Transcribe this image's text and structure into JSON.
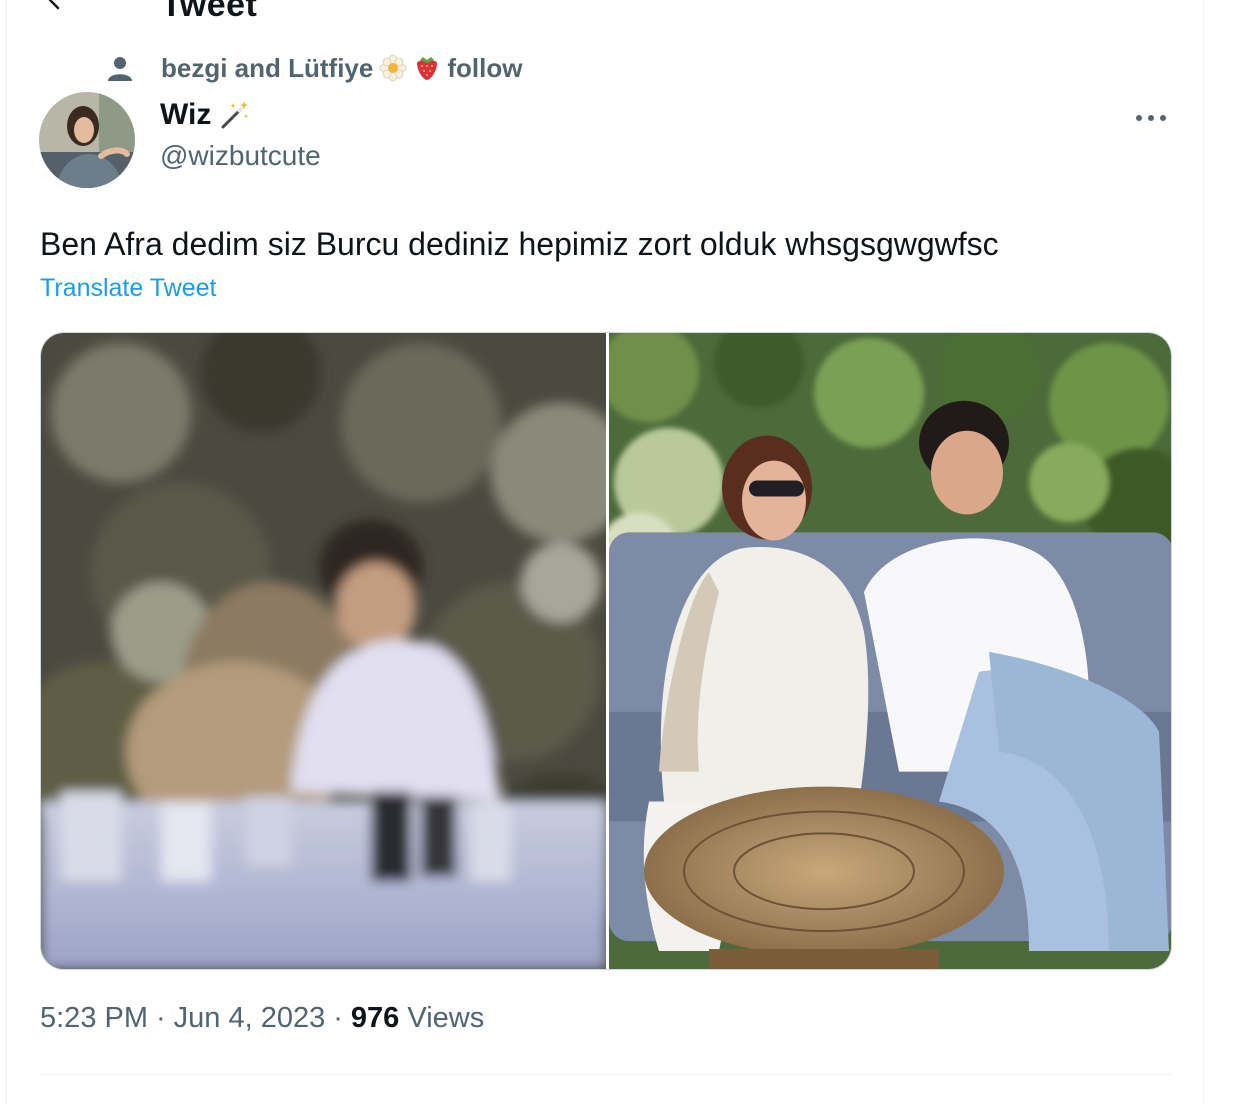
{
  "header": {
    "title": "Tweet",
    "back_icon": "arrow-left-icon"
  },
  "social_context": {
    "icon": "person-icon",
    "text": "bezgi and Lütfiye",
    "emojis": [
      "blossom-emoji",
      "strawberry-emoji"
    ],
    "action": "follow"
  },
  "author": {
    "display_name": "Wiz",
    "name_emoji": "magic-wand-emoji",
    "handle": "@wizbutcute"
  },
  "tweet": {
    "text": "Ben Afra dedim siz Burcu dediniz hepimiz zort olduk whsgsgwgwfsc",
    "translate_label": "Translate Tweet",
    "media": [
      {
        "alt": "blurry-photo-of-man-at-table"
      },
      {
        "alt": "woman-and-man-sitting-on-sofa"
      }
    ]
  },
  "meta": {
    "time": "5:23 PM",
    "separator": "·",
    "date": "Jun 4, 2023",
    "views_count": "976",
    "views_label": "Views"
  },
  "colors": {
    "primary_text": "#0f1419",
    "secondary_text": "#536471",
    "link": "#1d9bf0",
    "border": "#cfd9de"
  }
}
